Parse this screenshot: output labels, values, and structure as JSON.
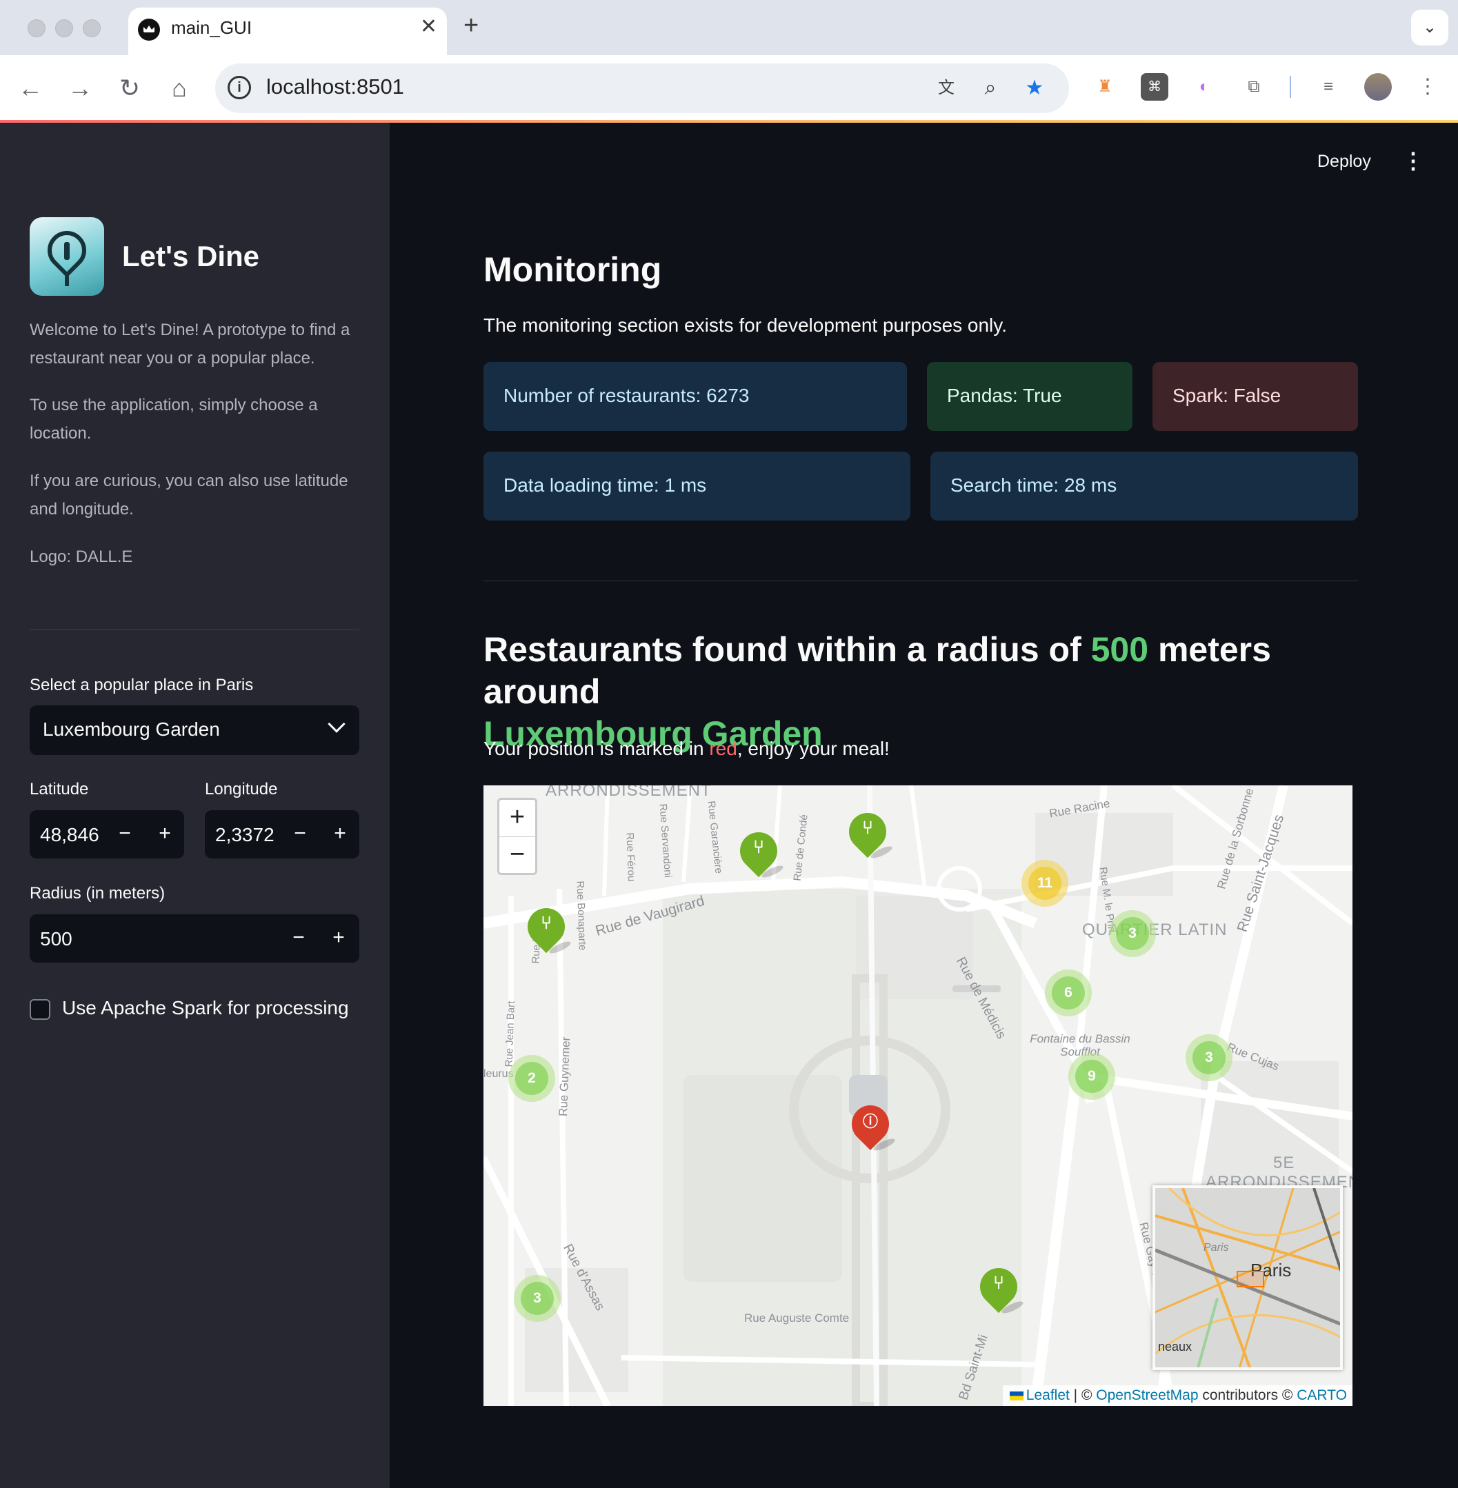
{
  "browser": {
    "tab_title": "main_GUI",
    "tab_close": "✕",
    "new_tab": "+",
    "tab_menu": "⌄",
    "url": "localhost:8501",
    "nav": {
      "back": "←",
      "forward": "→",
      "reload": "↻",
      "home": "⌂"
    },
    "icons": [
      "translate-icon",
      "zoom-icon",
      "bookmark-star-icon",
      "extension-icons",
      "profile-avatar",
      "chrome-menu-icon"
    ]
  },
  "sidebar": {
    "app_title": "Let's Dine",
    "intro_1": "Welcome to Let's Dine! A prototype to find a restaurant near you or a popular place.",
    "intro_2": "To use the application, simply choose a location.",
    "intro_3": "If you are curious, you can also use latitude and longitude.",
    "logo_credit": "Logo: DALL.E",
    "place_label": "Select a popular place in Paris",
    "place_value": "Luxembourg Garden",
    "latitude_label": "Latitude",
    "latitude_value": "48,846",
    "longitude_label": "Longitude",
    "longitude_value": "2,3372",
    "radius_label": "Radius (in meters)",
    "radius_value": "500",
    "minus": "−",
    "plus": "+",
    "spark_checkbox_label": "Use Apache Spark for processing",
    "spark_checked": false
  },
  "header": {
    "deploy": "Deploy",
    "menu": "⋮"
  },
  "monitoring": {
    "title": "Monitoring",
    "description": "The monitoring section exists for development purposes only.",
    "restaurants": "Number of restaurants: 6273",
    "pandas": "Pandas: True",
    "spark": "Spark: False",
    "loading_time": "Data loading time: 1 ms",
    "search_time": "Search time: 28 ms"
  },
  "results": {
    "title_prefix": "Restaurants found within a radius of ",
    "radius": "500",
    "title_middle": " meters around",
    "place": "Luxembourg Garden",
    "position_prefix": "Your position is marked in ",
    "position_color_word": "red",
    "position_suffix": ", enjoy your meal!"
  },
  "map": {
    "zoom_in": "+",
    "zoom_out": "−",
    "streets": {
      "arrondissement_top": "ARRONDISSEMENT",
      "rue_racine": "Rue Racine",
      "rue_vaugirard": "Rue de Vaugirard",
      "rue_medicis": "Rue de Médicis",
      "quartier_latin": "QUARTIER LATIN",
      "rue_saint_jacques": "Rue Saint-Jacques",
      "rue_sorbonne": "Rue de la Sorbonne",
      "fontaine": "Fontaine du Bassin Soufflot",
      "rue_cujas": "Rue Cujas",
      "cinquieme": "5E",
      "arrondissement_5": "ARRONDISSEMEN",
      "rue_assas": "Rue d'Assas",
      "rue_auguste_comte": "Rue Auguste Comte",
      "bd_saint_michel": "Bd Saint-Mi",
      "rue_gay_lussac": "Rue Gay-Lussac",
      "rue_guynemer": "Rue Guynemer",
      "rue_bonaparte": "Rue Bonaparte",
      "rue_ferou": "Rue Férou",
      "rue_servandoni": "Rue Servandoni",
      "rue_garanciere": "Rue Garancière",
      "rue_conde": "Rue de Condé",
      "rue_jean_bart": "Rue Jean Bart",
      "rue_madame": "Rue Mad",
      "fleurus": "leurus",
      "rue_prince": "Rue M. le Prin"
    },
    "clusters": [
      {
        "count": "11",
        "color": "yellow"
      },
      {
        "count": "3",
        "color": "green"
      },
      {
        "count": "6",
        "color": "green"
      },
      {
        "count": "3",
        "color": "green"
      },
      {
        "count": "9",
        "color": "green"
      },
      {
        "count": "2",
        "color": "green"
      },
      {
        "count": "3",
        "color": "green"
      }
    ],
    "restaurant_pin_icon": "utensils-icon",
    "user_pin_icon": "info-icon",
    "user_pin_color": "#d63e2a",
    "restaurant_pin_color": "#72b026",
    "minimap": {
      "city": "Paris",
      "sub": "Paris",
      "edge": "neaux"
    },
    "attribution": {
      "leaflet": "Leaflet",
      "sep": " | © ",
      "osm": "OpenStreetMap",
      "contributors": " contributors © ",
      "carto": "CARTO"
    }
  }
}
